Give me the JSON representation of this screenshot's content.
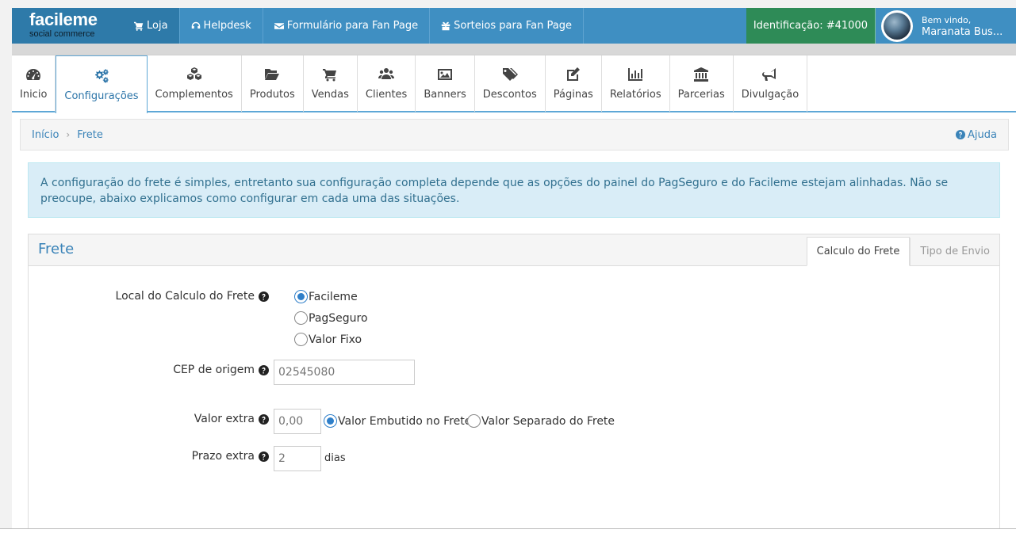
{
  "brand": {
    "logo": "facileme",
    "tagline": "social commerce"
  },
  "topnav": [
    {
      "label": "Loja",
      "icon": "cart-icon"
    },
    {
      "label": "Helpdesk",
      "icon": "headset-icon"
    },
    {
      "label": "Formulário para Fan Page",
      "icon": "envelope-icon"
    },
    {
      "label": "Sorteios para Fan Page",
      "icon": "gift-icon"
    }
  ],
  "identification": "Identificação: #41000",
  "user": {
    "greeting": "Bem vindo,",
    "name": "Maranata Bus..."
  },
  "modules": [
    {
      "label": "Inicio",
      "icon": "dashboard-icon"
    },
    {
      "label": "Configurações",
      "icon": "gears-icon"
    },
    {
      "label": "Complementos",
      "icon": "cubes-icon"
    },
    {
      "label": "Produtos",
      "icon": "folder-open-icon"
    },
    {
      "label": "Vendas",
      "icon": "cart-icon"
    },
    {
      "label": "Clientes",
      "icon": "users-icon"
    },
    {
      "label": "Banners",
      "icon": "picture-icon"
    },
    {
      "label": "Descontos",
      "icon": "tags-icon"
    },
    {
      "label": "Páginas",
      "icon": "edit-icon"
    },
    {
      "label": "Relatórios",
      "icon": "bar-chart-icon"
    },
    {
      "label": "Parcerias",
      "icon": "bank-icon"
    },
    {
      "label": "Divulgação",
      "icon": "bullhorn-icon"
    }
  ],
  "breadcrumb": {
    "home": "Início",
    "current": "Frete",
    "help": "Ajuda"
  },
  "alert": "A configuração do frete é simples, entretanto sua configuração completa depende que as opções do painel do PagSeguro e do Facileme estejam alinhadas. Não se preocupe, abaixo explicamos como configurar em cada uma das situações.",
  "panel": {
    "title": "Frete",
    "tabs": [
      "Calculo do Frete",
      "Tipo de Envio"
    ]
  },
  "form": {
    "local_label": "Local do Calculo do Frete",
    "local_options": [
      "Facileme",
      "PagSeguro",
      "Valor Fixo"
    ],
    "cep_label": "CEP de origem",
    "cep_placeholder": "02545080",
    "extra_label": "Valor extra",
    "extra_placeholder": "0,00",
    "extra_options": [
      "Valor Embutido no Frete",
      "Valor Separado do Frete"
    ],
    "prazo_label": "Prazo extra",
    "prazo_placeholder": "2",
    "prazo_suffix": "dias"
  },
  "colors": {
    "navbar": "#3f8fc2",
    "accent": "#2b74a8",
    "ident": "#2e8b57",
    "alert_bg": "#d9edf7"
  }
}
